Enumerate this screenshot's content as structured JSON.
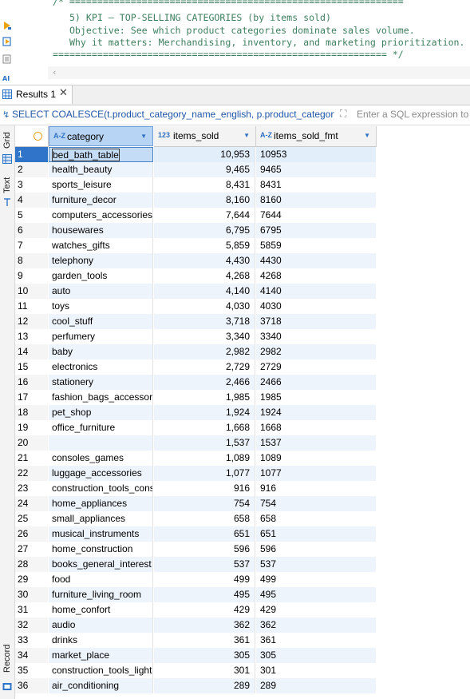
{
  "editor": {
    "lines": [
      "/* ============================================================",
      "   5) KPI — TOP-SELLING CATEGORIES (by items sold)",
      "   Objective: See which product categories dominate sales volume.",
      "   Why it matters: Merchandising, inventory, and marketing prioritization.",
      "============================================================ */"
    ],
    "scroll_left_icon": "chevron-left-icon"
  },
  "results_tab": {
    "label": "Results 1",
    "close": "✕"
  },
  "filter": {
    "sql_text": "SELECT COALESCE(t.product_category_name_english, p.product_category_r",
    "placeholder": "Enter a SQL expression to filter results (use Ctrl+Space)"
  },
  "side_tabs": {
    "grid": "Grid",
    "text": "Text",
    "record": "Record"
  },
  "columns": [
    {
      "type": "A-Z",
      "label": "category"
    },
    {
      "type": "123",
      "label": "items_sold"
    },
    {
      "type": "A-Z",
      "label": "items_sold_fmt"
    }
  ],
  "rows": [
    {
      "n": "1",
      "category": "bed_bath_table",
      "items_sold": "10,953",
      "fmt": "10953"
    },
    {
      "n": "2",
      "category": "health_beauty",
      "items_sold": "9,465",
      "fmt": "9465"
    },
    {
      "n": "3",
      "category": "sports_leisure",
      "items_sold": "8,431",
      "fmt": "8431"
    },
    {
      "n": "4",
      "category": "furniture_decor",
      "items_sold": "8,160",
      "fmt": "8160"
    },
    {
      "n": "5",
      "category": "computers_accessories",
      "items_sold": "7,644",
      "fmt": "7644"
    },
    {
      "n": "6",
      "category": "housewares",
      "items_sold": "6,795",
      "fmt": "6795"
    },
    {
      "n": "7",
      "category": "watches_gifts",
      "items_sold": "5,859",
      "fmt": "5859"
    },
    {
      "n": "8",
      "category": "telephony",
      "items_sold": "4,430",
      "fmt": "4430"
    },
    {
      "n": "9",
      "category": "garden_tools",
      "items_sold": "4,268",
      "fmt": "4268"
    },
    {
      "n": "10",
      "category": "auto",
      "items_sold": "4,140",
      "fmt": "4140"
    },
    {
      "n": "11",
      "category": "toys",
      "items_sold": "4,030",
      "fmt": "4030"
    },
    {
      "n": "12",
      "category": "cool_stuff",
      "items_sold": "3,718",
      "fmt": "3718"
    },
    {
      "n": "13",
      "category": "perfumery",
      "items_sold": "3,340",
      "fmt": "3340"
    },
    {
      "n": "14",
      "category": "baby",
      "items_sold": "2,982",
      "fmt": "2982"
    },
    {
      "n": "15",
      "category": "electronics",
      "items_sold": "2,729",
      "fmt": "2729"
    },
    {
      "n": "16",
      "category": "stationery",
      "items_sold": "2,466",
      "fmt": "2466"
    },
    {
      "n": "17",
      "category": "fashion_bags_accessorie",
      "items_sold": "1,985",
      "fmt": "1985"
    },
    {
      "n": "18",
      "category": "pet_shop",
      "items_sold": "1,924",
      "fmt": "1924"
    },
    {
      "n": "19",
      "category": "office_furniture",
      "items_sold": "1,668",
      "fmt": "1668"
    },
    {
      "n": "20",
      "category": "",
      "items_sold": "1,537",
      "fmt": "1537"
    },
    {
      "n": "21",
      "category": "consoles_games",
      "items_sold": "1,089",
      "fmt": "1089"
    },
    {
      "n": "22",
      "category": "luggage_accessories",
      "items_sold": "1,077",
      "fmt": "1077"
    },
    {
      "n": "23",
      "category": "construction_tools_cons",
      "items_sold": "916",
      "fmt": "916"
    },
    {
      "n": "24",
      "category": "home_appliances",
      "items_sold": "754",
      "fmt": "754"
    },
    {
      "n": "25",
      "category": "small_appliances",
      "items_sold": "658",
      "fmt": "658"
    },
    {
      "n": "26",
      "category": "musical_instruments",
      "items_sold": "651",
      "fmt": "651"
    },
    {
      "n": "27",
      "category": "home_construction",
      "items_sold": "596",
      "fmt": "596"
    },
    {
      "n": "28",
      "category": "books_general_interest",
      "items_sold": "537",
      "fmt": "537"
    },
    {
      "n": "29",
      "category": "food",
      "items_sold": "499",
      "fmt": "499"
    },
    {
      "n": "30",
      "category": "furniture_living_room",
      "items_sold": "495",
      "fmt": "495"
    },
    {
      "n": "31",
      "category": "home_confort",
      "items_sold": "429",
      "fmt": "429"
    },
    {
      "n": "32",
      "category": "audio",
      "items_sold": "362",
      "fmt": "362"
    },
    {
      "n": "33",
      "category": "drinks",
      "items_sold": "361",
      "fmt": "361"
    },
    {
      "n": "34",
      "category": "market_place",
      "items_sold": "305",
      "fmt": "305"
    },
    {
      "n": "35",
      "category": "construction_tools_light",
      "items_sold": "301",
      "fmt": "301"
    },
    {
      "n": "36",
      "category": "air_conditioning",
      "items_sold": "289",
      "fmt": "289"
    }
  ],
  "selected_row": "1",
  "colors": {
    "comment": "#3f7f5f",
    "accent": "#2f74c9",
    "alt_row": "#eef4fb",
    "sql_text": "#2254a5"
  }
}
